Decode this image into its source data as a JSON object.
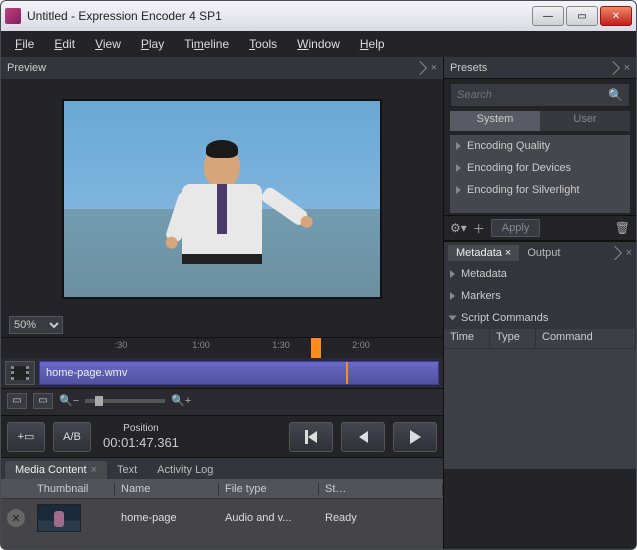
{
  "window": {
    "title": "Untitled - Expression Encoder 4 SP1"
  },
  "menu": {
    "file": "File",
    "edit": "Edit",
    "view": "View",
    "play": "Play",
    "timeline": "Timeline",
    "tools": "Tools",
    "window": "Window",
    "help": "Help"
  },
  "preview": {
    "title": "Preview",
    "zoom": "50%"
  },
  "timeline": {
    "ticks": [
      ":30",
      "1:00",
      "1:30",
      "2:00"
    ],
    "clip_name": "home-page.wmv"
  },
  "transport": {
    "add_ab": "A/B",
    "position_label": "Position",
    "timecode": "00:01:47.361"
  },
  "media": {
    "tabs": {
      "content": "Media Content",
      "text": "Text",
      "activity": "Activity Log"
    },
    "headers": {
      "thumb": "Thumbnail",
      "name": "Name",
      "type": "File type",
      "status": "St…"
    },
    "row": {
      "name": "home-page",
      "type": "Audio and v...",
      "status": "Ready"
    }
  },
  "presets": {
    "title": "Presets",
    "search_placeholder": "Search",
    "tab_system": "System",
    "tab_user": "User",
    "items": [
      "Encoding Quality",
      "Encoding for Devices",
      "Encoding for Silverlight"
    ],
    "apply": "Apply"
  },
  "right_tabs": {
    "metadata": "Metadata",
    "output": "Output"
  },
  "sections": {
    "metadata": "Metadata",
    "markers": "Markers",
    "script": "Script Commands"
  },
  "script": {
    "time": "Time",
    "type": "Type",
    "command": "Command"
  }
}
